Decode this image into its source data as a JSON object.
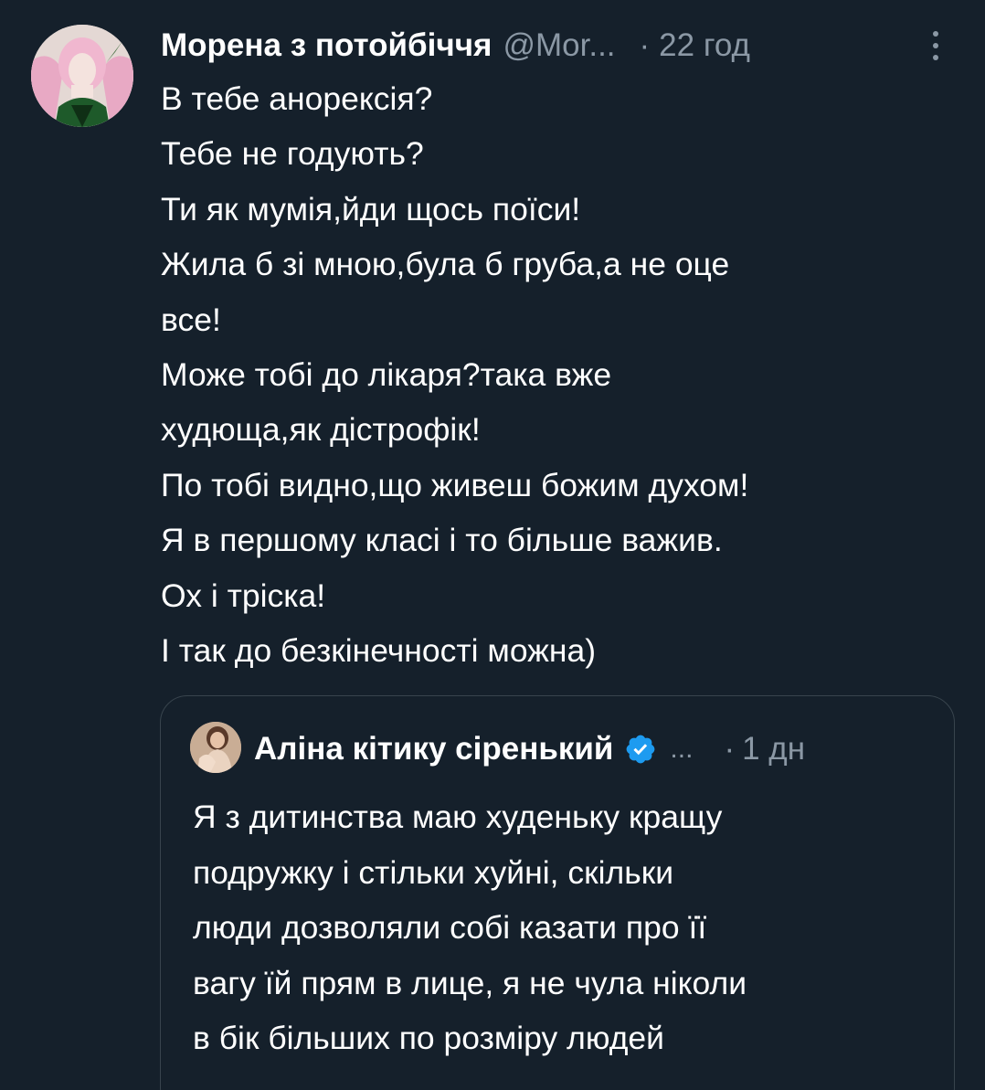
{
  "tweet": {
    "author_name": "Морена з потойбіччя",
    "handle": "@Mor...",
    "separator": "·",
    "time": "22 год",
    "more_icon": "more-vertical-icon",
    "lines": [
      "В тебе анорексія?",
      "Тебе не годують?",
      "Ти як мумія,йди щось поїси!",
      "Жила б зі мною,була б груба,а не оце",
      "все!",
      "Може тобі до лікаря?така вже",
      "худюща,як дістрофік!",
      "По тобі видно,що живеш божим духом!",
      "Я в першому класі і то більше важив.",
      "Ох і тріска!",
      "І так до безкінечності можна)"
    ]
  },
  "quote": {
    "author_name": "Аліна кітику сіренький",
    "verified_icon": "verified-badge-icon",
    "ellipsis": "...",
    "separator": "·",
    "time": "1 дн",
    "lines": [
      "Я з дитинства маю худеньку кращу",
      "подружку і стільки хуйні, скільки",
      "люди дозволяли собі казати про її",
      "вагу їй прям в лице, я не чула ніколи",
      "в бік більших по розміру людей"
    ]
  },
  "colors": {
    "background": "#15202b",
    "text": "#ffffff",
    "secondary": "#8b98a5",
    "border": "#38444d",
    "verified": "#1d9bf0"
  }
}
